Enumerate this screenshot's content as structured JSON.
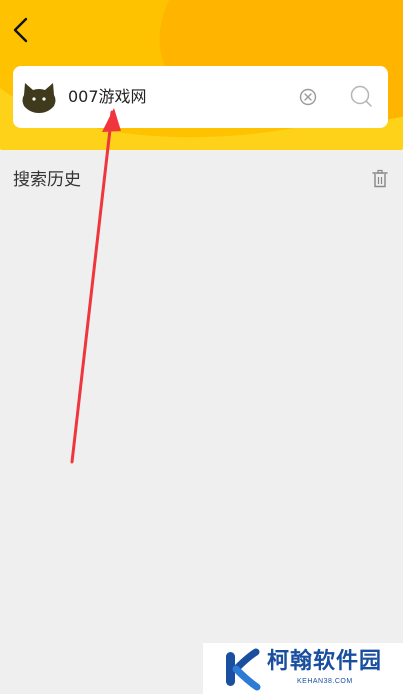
{
  "header": {
    "back_icon": "chevron-left-icon",
    "background_color": "#ffd21a"
  },
  "search": {
    "avatar_icon": "cat-icon",
    "query": "007游戏网",
    "clear_icon": "clear-circle-icon",
    "search_icon": "search-icon"
  },
  "history": {
    "title": "搜索历史",
    "delete_icon": "trash-icon"
  },
  "annotation": {
    "arrow_color": "#f0353d"
  },
  "watermark": {
    "title": "柯翰软件园",
    "url": "KEHAN38.COM",
    "color": "#1a4fa0"
  }
}
